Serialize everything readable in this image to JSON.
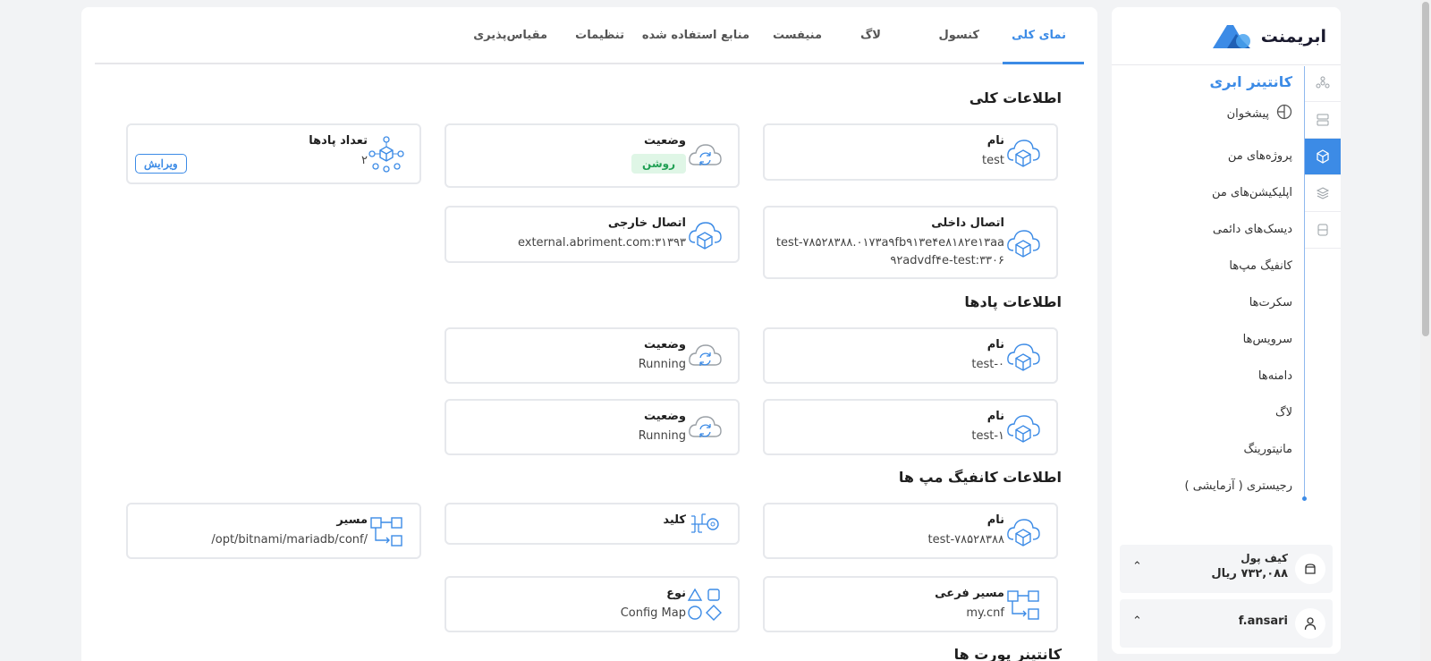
{
  "brand": {
    "name": "ابریمنت",
    "accent": "#3c8be6"
  },
  "sidebar": {
    "section_title": "کانتینر ابری",
    "dashboard": "پیشخوان",
    "items": [
      {
        "label": "پروژه‌های من"
      },
      {
        "label": "اپلیکیشن‌های من"
      },
      {
        "label": "دیسک‌های دائمی"
      },
      {
        "label": "کانفیگ مپ‌ها"
      },
      {
        "label": "سکرت‌ها"
      },
      {
        "label": "سرویس‌ها"
      },
      {
        "label": "دامنه‌ها"
      },
      {
        "label": "لاگ"
      },
      {
        "label": "مانیتورینگ"
      },
      {
        "label": "رجیستری ( آزمایشی )"
      }
    ],
    "rail_icons": [
      "cloud-nodes-icon",
      "server-icon",
      "cube-icon",
      "layers-icon",
      "database-icon"
    ],
    "wallet": {
      "label": "کیف پول",
      "value": "۷۳۲,۰۸۸ ریال"
    },
    "user": {
      "name": "f.ansari"
    }
  },
  "tabs": [
    {
      "label": "نمای کلی",
      "active": true
    },
    {
      "label": "کنسول"
    },
    {
      "label": "لاگ"
    },
    {
      "label": "منیفست"
    },
    {
      "label": "منابع استفاده شده"
    },
    {
      "label": "تنظیمات"
    },
    {
      "label": "مقیاس‌پذیری"
    }
  ],
  "general": {
    "title": "اطلاعات کلی",
    "name": {
      "label": "نام",
      "value": "test"
    },
    "status": {
      "label": "وضعیت",
      "value": "روشن"
    },
    "pods_count": {
      "label": "تعداد پادها",
      "value": "۲",
      "edit": "ویرایش"
    },
    "internal": {
      "label": "اتصال داخلی",
      "value": "test-۷۸۵۲۸۳۸۸.۰۱۷۳a۹fb۹۱۳e۴e۸۱۸۲e۱۳aa ۹۲advdf۴e-test:۳۳۰۶"
    },
    "external": {
      "label": "اتصال خارجی",
      "value": "external.abriment.com:۳۱۳۹۳"
    }
  },
  "pods": {
    "title": "اطلاعات پادها",
    "rows": [
      {
        "name_label": "نام",
        "name": "test-۰",
        "status_label": "وضعیت",
        "status": "Running"
      },
      {
        "name_label": "نام",
        "name": "test-۱",
        "status_label": "وضعیت",
        "status": "Running"
      }
    ]
  },
  "configmaps": {
    "title": "اطلاعات کانفیگ مپ ها",
    "name": {
      "label": "نام",
      "value": "test-۷۸۵۲۸۳۸۸"
    },
    "key": {
      "label": "کلید",
      "value": ""
    },
    "path": {
      "label": "مسیر",
      "value": "/opt/bitnami/mariadb/conf/"
    },
    "subpath": {
      "label": "مسیر فرعی",
      "value": "my.cnf"
    },
    "type": {
      "label": "نوع",
      "value": "Config Map"
    }
  },
  "ports": {
    "title": "کانتینر پورت ها"
  }
}
